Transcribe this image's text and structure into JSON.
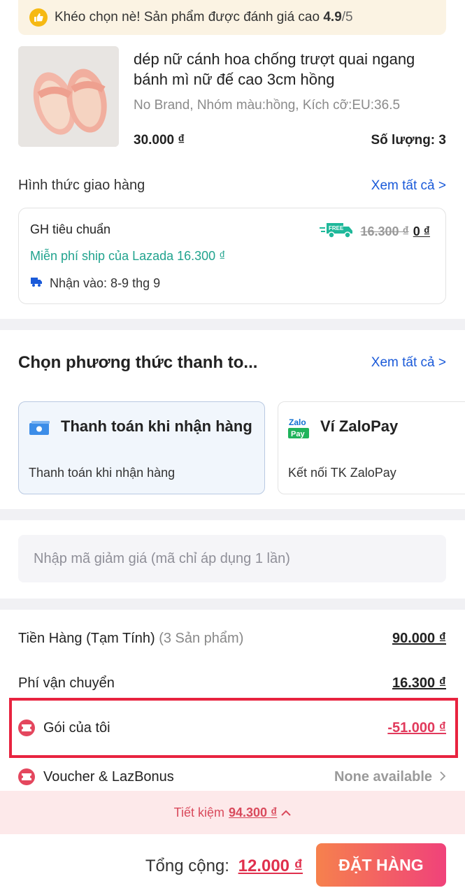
{
  "rating_banner": {
    "text": "Khéo chọn nè! Sản phẩm được đánh giá cao",
    "score": "4.9",
    "max": "/5"
  },
  "product": {
    "name": "dép nữ cánh hoa chống trượt quai ngang bánh mì nữ đế cao 3cm hồng",
    "variant": "No Brand, Nhóm màu:hồng, Kích cỡ:EU:36.5",
    "price": "30.000 ₫",
    "qty_label": "Số lượng:",
    "qty": "3"
  },
  "delivery": {
    "title": "Hình thức giao hàng",
    "see_all": "Xem tất cả >",
    "method": "GH tiêu chuẩn",
    "free_badge": "FREE",
    "old_fee": "16.300 ₫",
    "new_fee": "0 ₫",
    "free_ship_text": "Miễn phí ship của Lazada 16.300 ₫",
    "eta": "Nhận vào: 8-9 thg 9"
  },
  "payment": {
    "title": "Chọn phương thức thanh to...",
    "see_all": "Xem tất cả >",
    "options": [
      {
        "name": "Thanh toán khi nhận hàng",
        "sub": "Thanh toán khi nhận hàng"
      },
      {
        "name": "Ví ZaloPay",
        "sub": "Kết nối TK ZaloPay",
        "icon_text_top": "Zalo",
        "icon_text_bottom": "Pay"
      }
    ]
  },
  "voucher": {
    "placeholder": "Nhập mã giảm giá (mã chỉ áp dụng 1 lần)"
  },
  "summary": {
    "subtotal_label": "Tiền Hàng (Tạm Tính)",
    "subtotal_count": "(3 Sản phẩm)",
    "subtotal": "90.000 ₫",
    "shipping_label": "Phí vận chuyển",
    "shipping": "16.300 ₫",
    "package_label": "Gói của tôi",
    "package": "-51.000 ₫",
    "voucher_label": "Voucher & LazBonus",
    "voucher_value": "None available"
  },
  "savings": {
    "label": "Tiết kiệm",
    "amount": "94.300 ₫"
  },
  "footer": {
    "total_label": "Tổng cộng:",
    "total": "12.000 ₫",
    "order_button": "ĐẶT HÀNG"
  },
  "colors": {
    "accent_blue": "#1a5ad9",
    "accent_red": "#e13a5c",
    "free_green": "#21a38e",
    "highlight": "#e8233f"
  }
}
